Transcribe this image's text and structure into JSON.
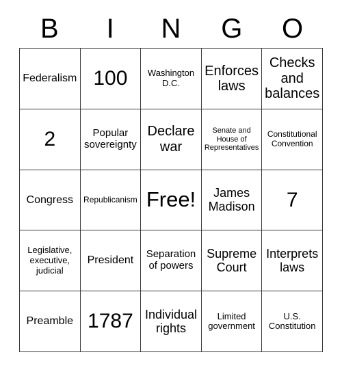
{
  "card": {
    "title": "BINGO",
    "header_letters": [
      "B",
      "I",
      "N",
      "G",
      "O"
    ],
    "rows": 5,
    "columns": 5,
    "free_space_label": "Free!",
    "colors": {
      "background": "#ffffff",
      "text": "#000000",
      "grid_line": "#3a3a3a"
    },
    "cells": [
      [
        {
          "text": "Federalism",
          "size": "xl"
        },
        {
          "text": "100",
          "size": "num"
        },
        {
          "text": "Washington D.C.",
          "size": "md"
        },
        {
          "text": "Enforces laws",
          "size": "3xl"
        },
        {
          "text": "Checks and balances",
          "size": "3xl"
        }
      ],
      [
        {
          "text": "2",
          "size": "num"
        },
        {
          "text": "Popular sovereignty",
          "size": "lg"
        },
        {
          "text": "Declare war",
          "size": "3xl"
        },
        {
          "text": "Senate and House of Representatives",
          "size": "xs"
        },
        {
          "text": "Constitutional Convention",
          "size": "sm"
        }
      ],
      [
        {
          "text": "Congress",
          "size": "xl"
        },
        {
          "text": "Republicanism",
          "size": "sm"
        },
        {
          "text": "Free!",
          "size": "free"
        },
        {
          "text": "James Madison",
          "size": "2xl"
        },
        {
          "text": "7",
          "size": "num"
        }
      ],
      [
        {
          "text": "Legislative, executive, judicial",
          "size": "md"
        },
        {
          "text": "President",
          "size": "xl"
        },
        {
          "text": "Separation of powers",
          "size": "lg"
        },
        {
          "text": "Supreme Court",
          "size": "2xl"
        },
        {
          "text": "Interprets laws",
          "size": "2xl"
        }
      ],
      [
        {
          "text": "Preamble",
          "size": "xl"
        },
        {
          "text": "1787",
          "size": "num"
        },
        {
          "text": "Individual rights",
          "size": "2xl"
        },
        {
          "text": "Limited government",
          "size": "md"
        },
        {
          "text": "U.S. Constitution",
          "size": "md"
        }
      ]
    ]
  }
}
